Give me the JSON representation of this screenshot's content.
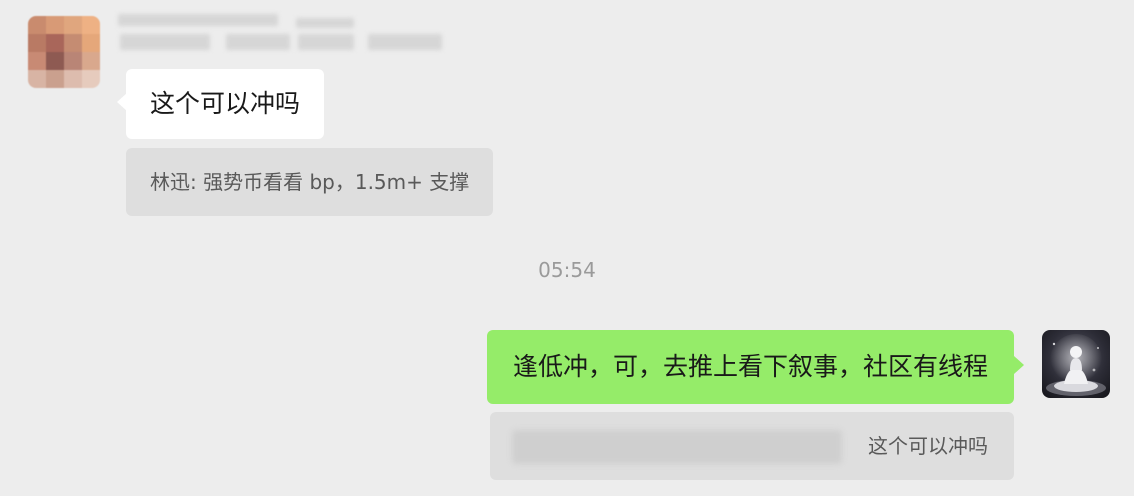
{
  "conversation": {
    "incoming": {
      "avatar_icon": "blurred-user-avatar",
      "message": "这个可以冲吗",
      "quote": "林迅: 强势币看看 bp，1.5m+ 支撑"
    },
    "timestamp": "05:54",
    "outgoing": {
      "avatar_icon": "meditating-figure-avatar",
      "message": "逢低冲，可，去推上看下叙事，社区有线程",
      "quote": "这个可以冲吗"
    }
  },
  "colors": {
    "background": "#ededed",
    "incoming_bubble": "#ffffff",
    "outgoing_bubble": "#95ec69",
    "quote_background": "#dedede",
    "timestamp_text": "#9a9a9a"
  }
}
